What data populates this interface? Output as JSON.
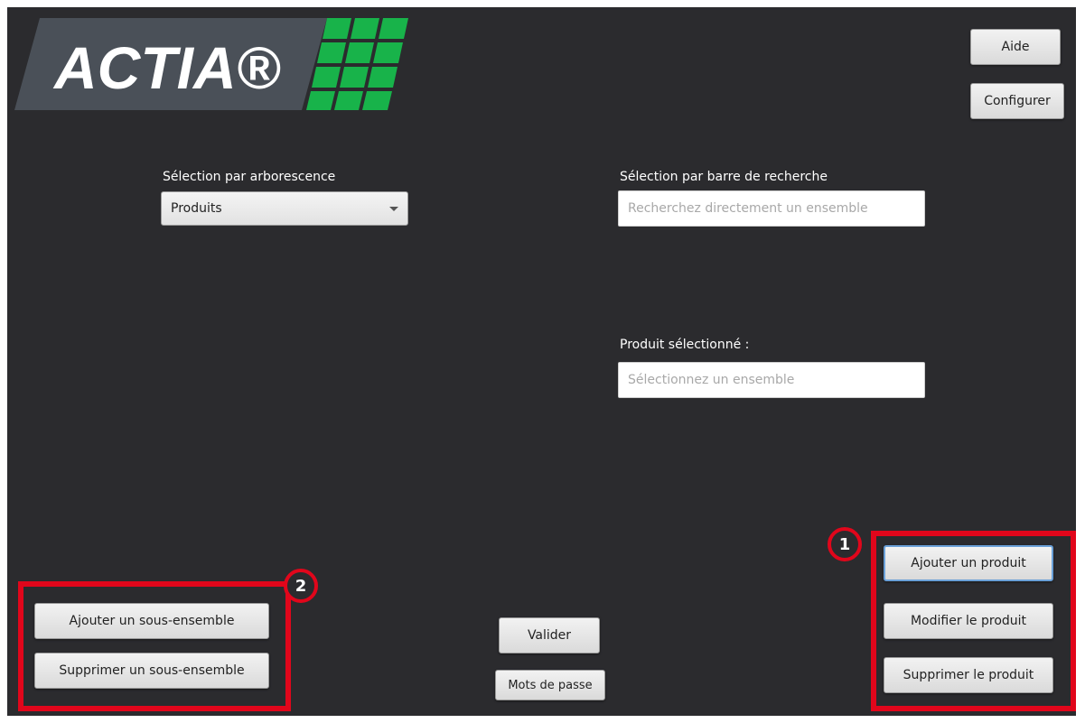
{
  "brand": {
    "logo_text": "ACTIA®",
    "colors": {
      "panel": "#4a5058",
      "green": "#18b34a",
      "annotation_red": "#e1061b",
      "background": "#2b2b2e"
    }
  },
  "toolbar": {
    "help_label": "Aide",
    "configure_label": "Configurer"
  },
  "tree_selection": {
    "label": "Sélection par arborescence",
    "selected_value": "Produits"
  },
  "search_selection": {
    "label": "Sélection par barre de recherche",
    "placeholder": "Recherchez directement un ensemble"
  },
  "selected_product": {
    "label": "Produit sélectionné :",
    "placeholder": "Sélectionnez un ensemble"
  },
  "product_actions": {
    "add_label": "Ajouter un produit",
    "modify_label": "Modifier le produit",
    "delete_label": "Supprimer le produit"
  },
  "subassembly_actions": {
    "add_label": "Ajouter un sous-ensemble",
    "delete_label": "Supprimer un sous-ensemble"
  },
  "footer": {
    "validate_label": "Valider",
    "passwords_label": "Mots de passe"
  },
  "annotations": {
    "badge_1": "1",
    "badge_2": "2"
  }
}
